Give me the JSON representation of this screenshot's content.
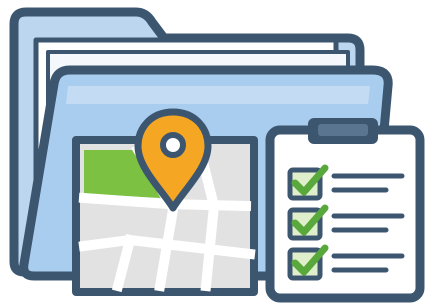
{
  "illustration": {
    "icons": [
      "folder-icon",
      "map-icon",
      "location-pin-icon",
      "clipboard-icon",
      "checkbox-icon"
    ],
    "checklist": {
      "items": [
        {
          "checked": true
        },
        {
          "checked": true
        },
        {
          "checked": true
        }
      ]
    },
    "colors": {
      "outline": "#3d5670",
      "folder_back": "#bcd6ef",
      "folder_front": "#a9cdef",
      "folder_highlight": "#cfe3f6",
      "paper": "#ffffff",
      "map_road": "#ffffff",
      "map_block": "#e2e2e2",
      "map_park": "#7cc142",
      "pin": "#f5a623",
      "check": "#58a83b",
      "check_box": "#dfeecb"
    }
  }
}
